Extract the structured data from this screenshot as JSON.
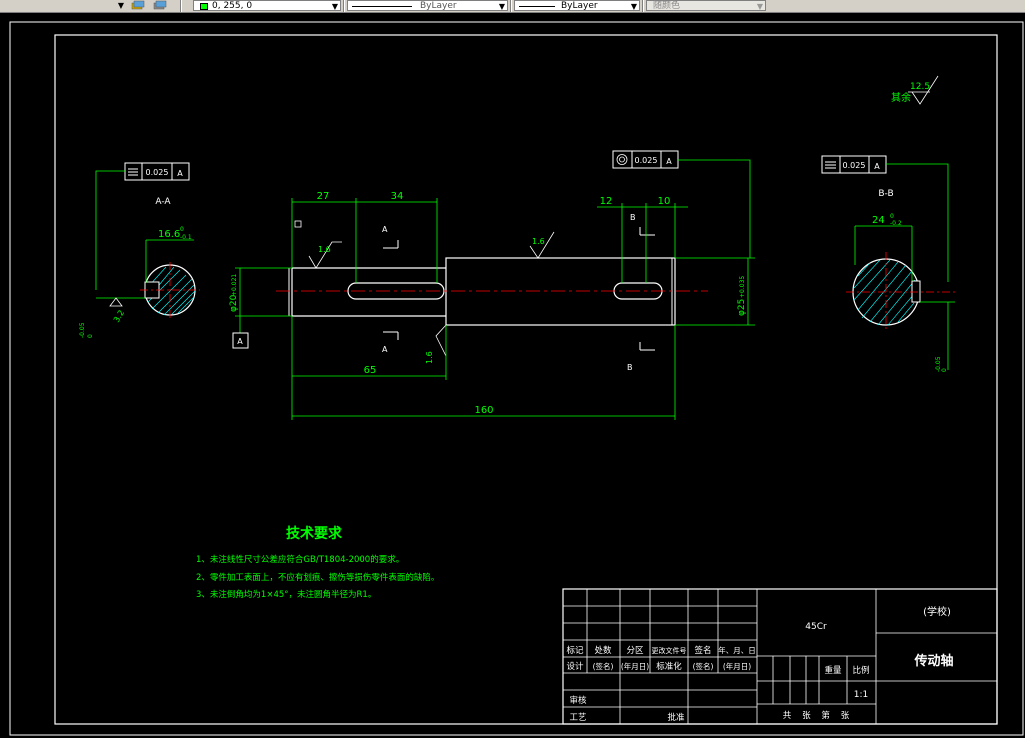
{
  "toolbar": {
    "color_combo": "0, 255, 0",
    "linetype_combo": "ByLayer",
    "lineweight_combo": "ByLayer",
    "plotstyle_combo": "随颜色",
    "arrow": "▼"
  },
  "drawing": {
    "section_aa": "A-A",
    "section_bb": "B-B",
    "gtol_left": {
      "value": "0.025",
      "datum": "A"
    },
    "gtol_mid": {
      "value": "0.025",
      "datum": "A"
    },
    "gtol_right": {
      "value": "0.025",
      "datum": "A"
    },
    "keyway_left_dim": "16.6",
    "keyway_right_dim": "24",
    "tol_zero": "0",
    "tol_left": "-0.1",
    "tol_right": "-0.2",
    "roughness_rest": "其余",
    "roughness_rest_val": "12.5",
    "roughness_val": "1.6",
    "roughness_left_val": "3.2",
    "dim_27": "27",
    "dim_34": "34",
    "dim_12": "12",
    "dim_10": "10",
    "dim_65": "65",
    "dim_160": "160",
    "dia_left": "φ20",
    "dia_left_tol": "+0.021",
    "dia_right": "φ25",
    "dia_right_tol": "+0.035",
    "aa_side_tol": "-0.05",
    "bb_side_tol": "-0.05",
    "label_a": "A",
    "label_b": "B",
    "datum_a": "A"
  },
  "tech": {
    "title": "技术要求",
    "items": [
      "1、未注线性尺寸公差应符合GB/T1804-2000的要求。",
      "2、零件加工表面上，不应有划痕、擦伤等损伤零件表面的缺陷。",
      "3、未注倒角均为1×45°，未注圆角半径为R1。"
    ]
  },
  "title_block": {
    "material": "45Cr",
    "school": "(学校)",
    "part_name": "传动轴",
    "h_mark": "标记",
    "h_count": "处数",
    "h_zone": "分区",
    "h_doc": "更改文件号",
    "h_sign": "签名",
    "h_date": "年、月、日",
    "r_design": "设计",
    "sig": "(签名)",
    "date": "(年月日)",
    "std": "标准化",
    "weight": "重量",
    "scale_label": "比例",
    "scale": "1:1",
    "review": "审核",
    "process": "工艺",
    "approve": "批准",
    "sheets": "共    张    第    张"
  },
  "colors": {
    "background": "#000000",
    "geometry": "#ffffff",
    "dimension": "#00ff00",
    "centerline": "#ff0000",
    "hatch": "#00ffff",
    "text": "#ffff00"
  }
}
